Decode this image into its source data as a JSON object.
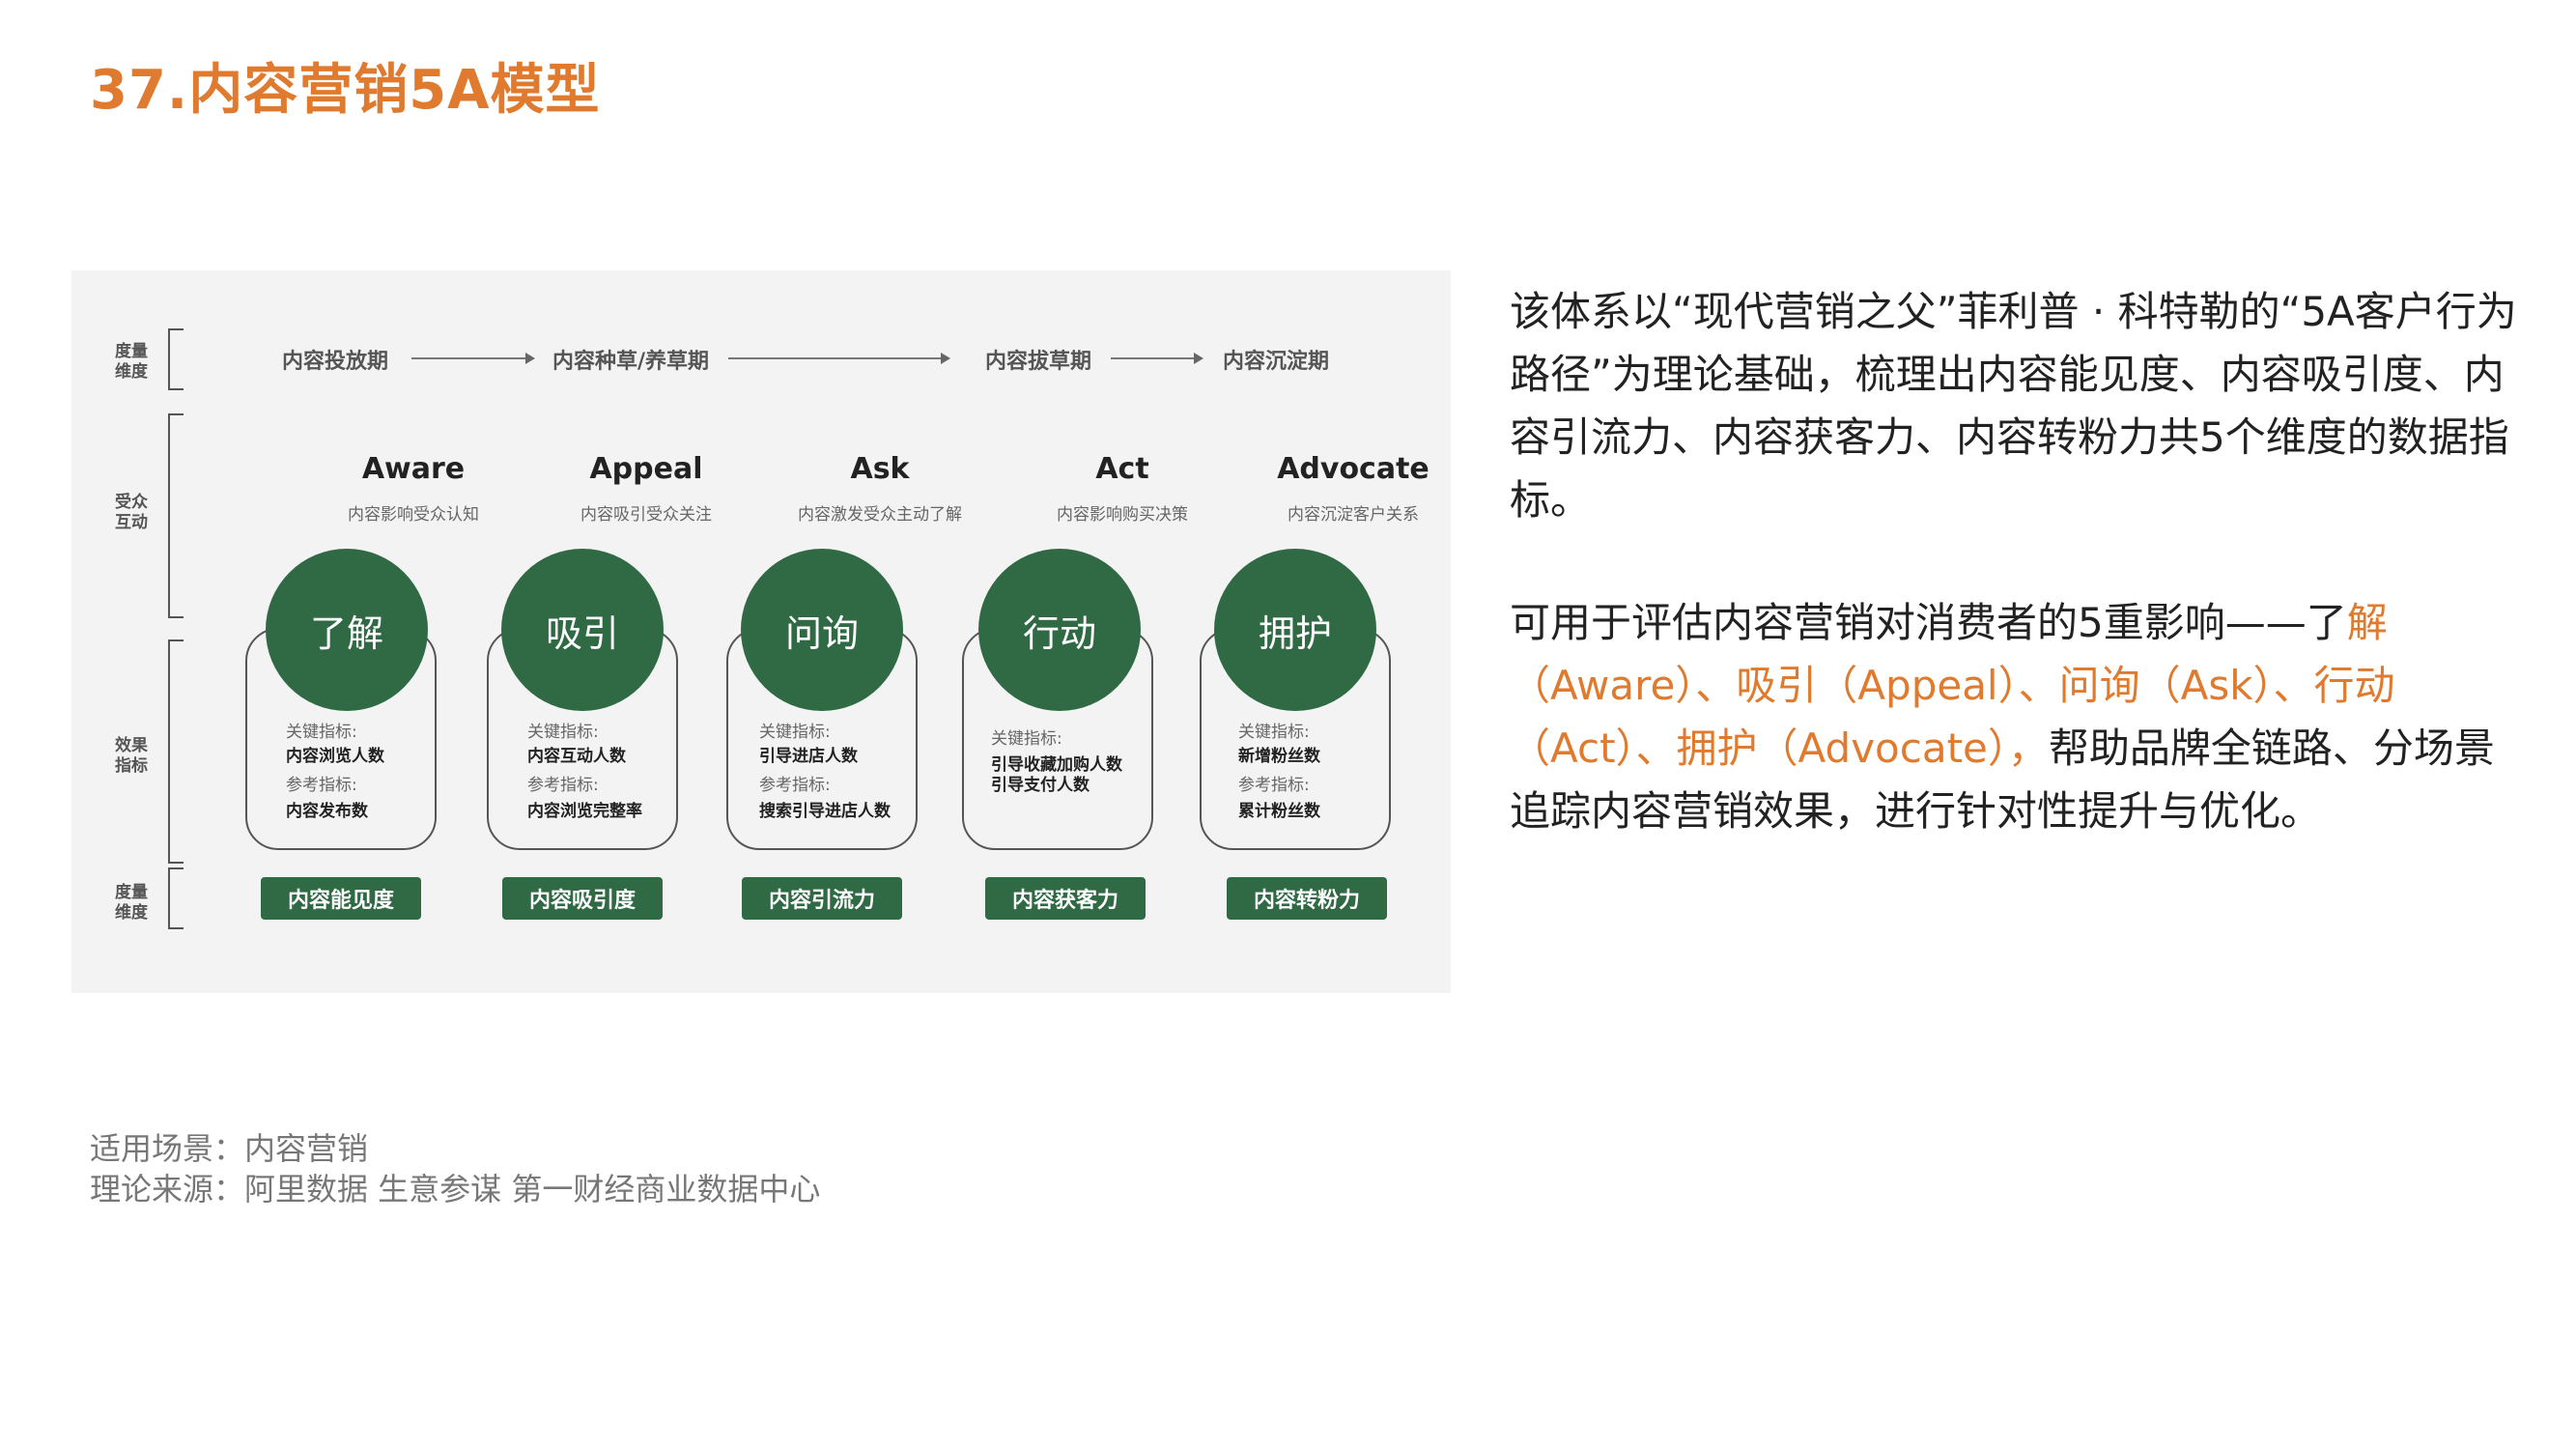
{
  "page_title": "37.内容营销5A模型",
  "diagram": {
    "row_labels": {
      "top_dimension": "度量维度",
      "interaction": "受众互动",
      "metrics": "效果指标",
      "bottom_dimension": "度量维度"
    },
    "stages": [
      "内容投放期",
      "内容种草/养草期",
      "内容拔草期",
      "内容沉淀期"
    ],
    "columns": [
      {
        "title": "Aware",
        "subtitle": "内容影响受众认知",
        "circle": "了解",
        "key_label": "关键指标:",
        "key": "内容浏览人数",
        "ref_label": "参考指标:",
        "ref": "内容发布数",
        "badge": "内容能见度"
      },
      {
        "title": "Appeal",
        "subtitle": "内容吸引受众关注",
        "circle": "吸引",
        "key_label": "关键指标:",
        "key": "内容互动人数",
        "ref_label": "参考指标:",
        "ref": "内容浏览完整率",
        "badge": "内容吸引度"
      },
      {
        "title": "Ask",
        "subtitle": "内容激发受众主动了解",
        "circle": "问询",
        "key_label": "关键指标:",
        "key": "引导进店人数",
        "ref_label": "参考指标:",
        "ref": "搜索引导进店人数",
        "badge": "内容引流力"
      },
      {
        "title": "Act",
        "subtitle": "内容影响购买决策",
        "circle": "行动",
        "key_label": "关键指标:",
        "key": "引导收藏加购人数",
        "key2": "引导支付人数",
        "badge": "内容获客力"
      },
      {
        "title": "Advocate",
        "subtitle": "内容沉淀客户关系",
        "circle": "拥护",
        "key_label": "关键指标:",
        "key": "新增粉丝数",
        "ref_label": "参考指标:",
        "ref": "累计粉丝数",
        "badge": "内容转粉力"
      }
    ]
  },
  "description": {
    "p1": "该体系以“现代营销之父”菲利普 · 科特勒的“5A客户行为路径”为理论基础，梳理出内容能见度、内容吸引度、内容引流力、内容获客力、内容转粉力共5个维度的数据指标。",
    "p2_prefix": "可用于评估内容营销对消费者的5重影响——了",
    "p2_highlight": "解（Aware）、吸引（Appeal）、问询（Ask）、行动（Act）、拥护（Advocate），",
    "p2_suffix": "帮助品牌全链路、分场景追踪内容营销效果，进行针对性提升与优化。"
  },
  "footer": {
    "scene": "适用场景：内容营销",
    "source": "理论来源：阿里数据  生意参谋  第一财经商业数据中心"
  },
  "colors": {
    "accent": "#e07a2e",
    "green": "#2f6a45"
  }
}
